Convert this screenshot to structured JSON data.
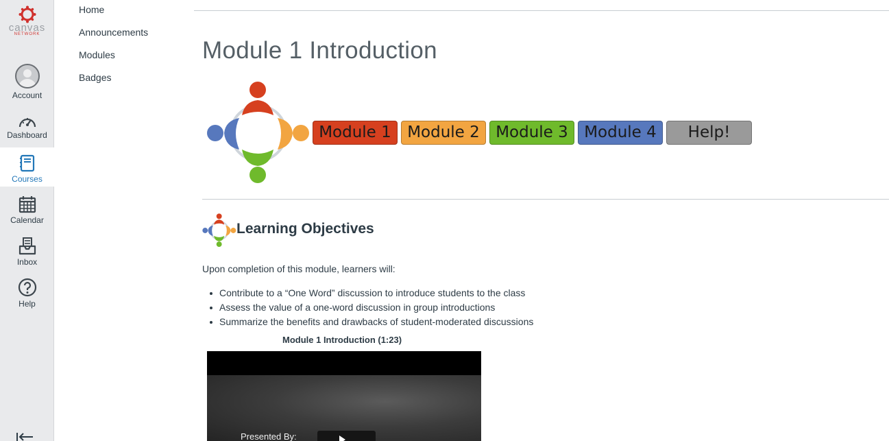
{
  "global_nav": {
    "logo": {
      "word": "canvas",
      "sub": "NETWORK"
    },
    "items": [
      {
        "label": "Account",
        "icon": "user-avatar-icon"
      },
      {
        "label": "Dashboard",
        "icon": "speedometer-icon"
      },
      {
        "label": "Courses",
        "icon": "book-icon",
        "active": true
      },
      {
        "label": "Calendar",
        "icon": "calendar-icon"
      },
      {
        "label": "Inbox",
        "icon": "inbox-icon"
      },
      {
        "label": "Help",
        "icon": "question-icon"
      }
    ],
    "collapse_icon": "collapse-arrow-icon",
    "active_color": "#2277b8"
  },
  "course_nav": {
    "links": [
      "Home",
      "Announcements",
      "Modules",
      "Badges"
    ]
  },
  "page": {
    "title": "Module 1 Introduction",
    "module_buttons": [
      {
        "label": "Module 1",
        "color": "#d6401f"
      },
      {
        "label": "Module 2",
        "color": "#f2a541"
      },
      {
        "label": "Module 3",
        "color": "#6fba2c"
      },
      {
        "label": "Module 4",
        "color": "#5778bd"
      },
      {
        "label": "Help!",
        "color": "#9a9a9a"
      }
    ],
    "objectives_heading": "Learning Objectives",
    "intro": "Upon completion of this module, learners will:",
    "objectives": [
      "Contribute to a “One Word” discussion to introduce students to the class",
      "Assess the value of a one-word discussion in group introductions",
      "Summarize the benefits and drawbacks of student-moderated discussions"
    ],
    "video": {
      "caption": "Module 1 Introduction (1:23)",
      "presented_by": "Presented By:",
      "play_icon": "play-icon"
    }
  }
}
